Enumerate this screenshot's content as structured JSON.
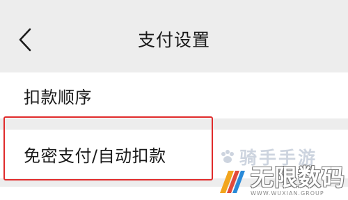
{
  "header": {
    "back_icon": "chevron-left-icon",
    "title": "支付设置"
  },
  "settings": {
    "items": [
      {
        "label": "扣款顺序"
      },
      {
        "label": "免密支付/自动扣款"
      }
    ]
  },
  "annotation": {
    "highlight_color": "#e02b2b"
  },
  "watermark": {
    "top_text": "骑手手游",
    "title": "无限数码",
    "subtitle": "WWW.WUXIAN.GROUP",
    "logo_icon": "wuxian-logo-icon"
  }
}
